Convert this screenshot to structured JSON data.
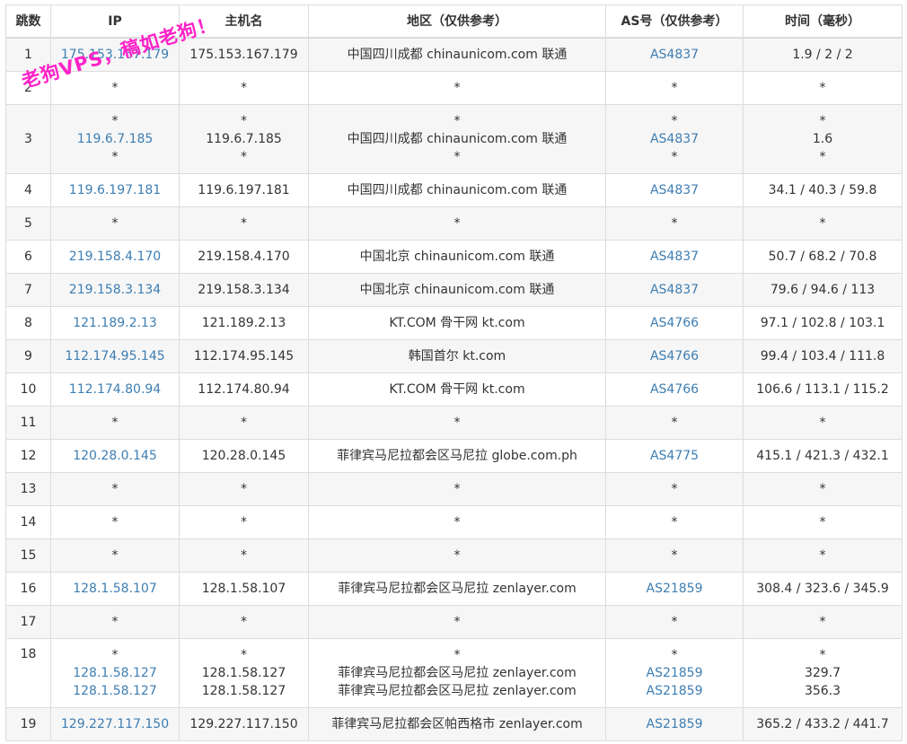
{
  "headers": {
    "hop": "跳数",
    "ip": "IP",
    "host": "主机名",
    "region": "地区（仅供参考）",
    "as": "AS号（仅供参考）",
    "time": "时间（毫秒）"
  },
  "watermark": "老狗VPS，稿如老狗！",
  "rows": [
    {
      "hop": "1",
      "ip": [
        "175.153.167.179"
      ],
      "host": [
        "175.153.167.179"
      ],
      "region": [
        "中国四川成都 chinaunicom.com 联通"
      ],
      "as": [
        "AS4837"
      ],
      "time": [
        "1.9 / 2 / 2"
      ]
    },
    {
      "hop": "2",
      "ip": [
        "*"
      ],
      "host": [
        "*"
      ],
      "region": [
        "*"
      ],
      "as": [
        "*"
      ],
      "time": [
        "*"
      ]
    },
    {
      "hop": "3",
      "ip": [
        "*",
        "119.6.7.185",
        "*"
      ],
      "host": [
        "*",
        "119.6.7.185",
        "*"
      ],
      "region": [
        "*",
        "中国四川成都 chinaunicom.com 联通",
        "*"
      ],
      "as": [
        "*",
        "AS4837",
        "*"
      ],
      "time": [
        "*",
        "1.6",
        "*"
      ]
    },
    {
      "hop": "4",
      "ip": [
        "119.6.197.181"
      ],
      "host": [
        "119.6.197.181"
      ],
      "region": [
        "中国四川成都 chinaunicom.com 联通"
      ],
      "as": [
        "AS4837"
      ],
      "time": [
        "34.1 / 40.3 / 59.8"
      ]
    },
    {
      "hop": "5",
      "ip": [
        "*"
      ],
      "host": [
        "*"
      ],
      "region": [
        "*"
      ],
      "as": [
        "*"
      ],
      "time": [
        "*"
      ]
    },
    {
      "hop": "6",
      "ip": [
        "219.158.4.170"
      ],
      "host": [
        "219.158.4.170"
      ],
      "region": [
        "中国北京 chinaunicom.com 联通"
      ],
      "as": [
        "AS4837"
      ],
      "time": [
        "50.7 / 68.2 / 70.8"
      ]
    },
    {
      "hop": "7",
      "ip": [
        "219.158.3.134"
      ],
      "host": [
        "219.158.3.134"
      ],
      "region": [
        "中国北京 chinaunicom.com 联通"
      ],
      "as": [
        "AS4837"
      ],
      "time": [
        "79.6 / 94.6 / 113"
      ]
    },
    {
      "hop": "8",
      "ip": [
        "121.189.2.13"
      ],
      "host": [
        "121.189.2.13"
      ],
      "region": [
        "KT.COM 骨干网 kt.com"
      ],
      "as": [
        "AS4766"
      ],
      "time": [
        "97.1 / 102.8 / 103.1"
      ]
    },
    {
      "hop": "9",
      "ip": [
        "112.174.95.145"
      ],
      "host": [
        "112.174.95.145"
      ],
      "region": [
        "韩国首尔 kt.com"
      ],
      "as": [
        "AS4766"
      ],
      "time": [
        "99.4 / 103.4 / 111.8"
      ]
    },
    {
      "hop": "10",
      "ip": [
        "112.174.80.94"
      ],
      "host": [
        "112.174.80.94"
      ],
      "region": [
        "KT.COM 骨干网 kt.com"
      ],
      "as": [
        "AS4766"
      ],
      "time": [
        "106.6 / 113.1 / 115.2"
      ]
    },
    {
      "hop": "11",
      "ip": [
        "*"
      ],
      "host": [
        "*"
      ],
      "region": [
        "*"
      ],
      "as": [
        "*"
      ],
      "time": [
        "*"
      ]
    },
    {
      "hop": "12",
      "ip": [
        "120.28.0.145"
      ],
      "host": [
        "120.28.0.145"
      ],
      "region": [
        "菲律宾马尼拉都会区马尼拉 globe.com.ph"
      ],
      "as": [
        "AS4775"
      ],
      "time": [
        "415.1 / 421.3 / 432.1"
      ]
    },
    {
      "hop": "13",
      "ip": [
        "*"
      ],
      "host": [
        "*"
      ],
      "region": [
        "*"
      ],
      "as": [
        "*"
      ],
      "time": [
        "*"
      ]
    },
    {
      "hop": "14",
      "ip": [
        "*"
      ],
      "host": [
        "*"
      ],
      "region": [
        "*"
      ],
      "as": [
        "*"
      ],
      "time": [
        "*"
      ]
    },
    {
      "hop": "15",
      "ip": [
        "*"
      ],
      "host": [
        "*"
      ],
      "region": [
        "*"
      ],
      "as": [
        "*"
      ],
      "time": [
        "*"
      ]
    },
    {
      "hop": "16",
      "ip": [
        "128.1.58.107"
      ],
      "host": [
        "128.1.58.107"
      ],
      "region": [
        "菲律宾马尼拉都会区马尼拉 zenlayer.com"
      ],
      "as": [
        "AS21859"
      ],
      "time": [
        "308.4 / 323.6 / 345.9"
      ]
    },
    {
      "hop": "17",
      "ip": [
        "*"
      ],
      "host": [
        "*"
      ],
      "region": [
        "*"
      ],
      "as": [
        "*"
      ],
      "time": [
        "*"
      ]
    },
    {
      "hop": "18",
      "ip": [
        "*",
        "128.1.58.127",
        "128.1.58.127"
      ],
      "host": [
        "*",
        "128.1.58.127",
        "128.1.58.127"
      ],
      "region": [
        "*",
        "菲律宾马尼拉都会区马尼拉 zenlayer.com",
        "菲律宾马尼拉都会区马尼拉 zenlayer.com"
      ],
      "as": [
        "*",
        "AS21859",
        "AS21859"
      ],
      "time": [
        "*",
        "329.7",
        "356.3"
      ]
    },
    {
      "hop": "19",
      "ip": [
        "129.227.117.150"
      ],
      "host": [
        "129.227.117.150"
      ],
      "region": [
        "菲律宾马尼拉都会区帕西格市 zenlayer.com"
      ],
      "as": [
        "AS21859"
      ],
      "time": [
        "365.2 / 433.2 / 441.7"
      ]
    }
  ]
}
